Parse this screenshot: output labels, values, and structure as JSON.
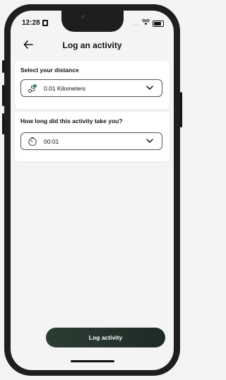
{
  "status_bar": {
    "time": "12:28",
    "signal_text": "...."
  },
  "header": {
    "back_icon": "arrow-left-icon",
    "title": "Log an activity"
  },
  "distance": {
    "label": "Select your distance",
    "icon": "route-icon",
    "value": "0.01 Kilometers"
  },
  "duration": {
    "label": "How long did this activity take you?",
    "icon": "timer-icon",
    "value": "00:01"
  },
  "cta": {
    "label": "Log activity"
  },
  "colors": {
    "primary": "#26342d",
    "background": "#f4f4f4",
    "card": "#ffffff"
  }
}
